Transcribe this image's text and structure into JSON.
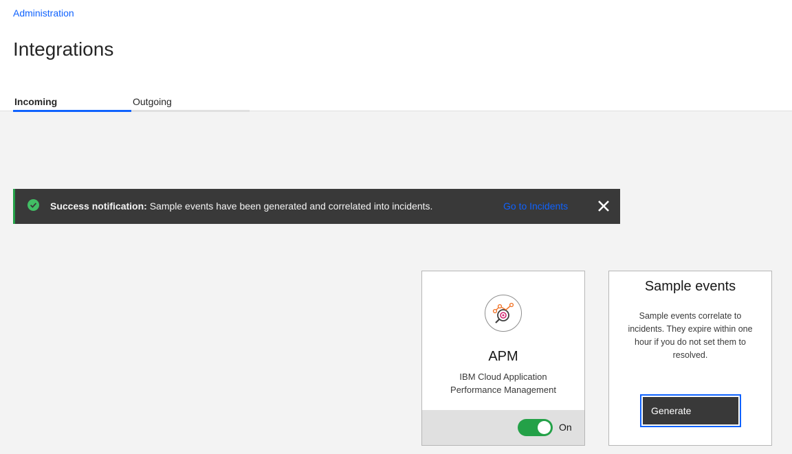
{
  "breadcrumb": {
    "label": "Administration"
  },
  "page": {
    "title": "Integrations"
  },
  "tabs": [
    {
      "label": "Incoming",
      "active": true
    },
    {
      "label": "Outgoing",
      "active": false
    }
  ],
  "notification": {
    "kind": "success",
    "title": "Success notification:",
    "message": "Sample events have been generated and correlated into incidents.",
    "link_label": "Go to Incidents",
    "icon": "checkmark-filled-icon",
    "close_icon": "close-icon"
  },
  "apm_card": {
    "name": "APM",
    "description": "IBM Cloud Application Performance Management",
    "logo_icon": "apm-monitor-icon",
    "toggle": {
      "state": "on",
      "label": "On"
    }
  },
  "sample_card": {
    "title": "Sample events",
    "description": "Sample events correlate to incidents. They expire within one hour if you do not set them to resolved.",
    "button_label": "Generate"
  },
  "colors": {
    "link": "#0f62fe",
    "success": "#24a148",
    "notification_bg": "#393939",
    "page_bg": "#f3f3f3"
  }
}
